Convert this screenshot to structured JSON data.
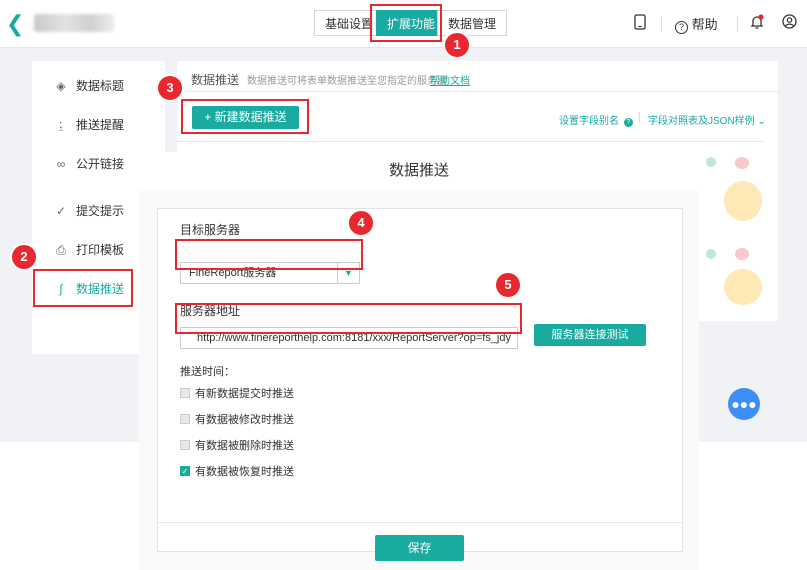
{
  "topbar": {
    "tabs": [
      "基础设置",
      "扩展功能",
      "数据管理"
    ],
    "active_tab": "扩展功能",
    "help_label": "帮助"
  },
  "sidebar": {
    "items": [
      {
        "label": "数据标题",
        "icon": "tag-icon"
      },
      {
        "label": "推送提醒",
        "icon": "bell-icon"
      },
      {
        "label": "公开链接",
        "icon": "link-icon"
      },
      {
        "label": "提交提示",
        "icon": "check-circle-icon"
      },
      {
        "label": "打印模板",
        "icon": "printer-icon"
      },
      {
        "label": "数据推送",
        "icon": "chart-icon"
      }
    ],
    "active": "数据推送"
  },
  "main": {
    "title": "数据推送",
    "description": "数据推送可将表单数据推送至您指定的服务器",
    "help_link": "帮助文档",
    "new_button": "+ 新建数据推送",
    "alias_link": "设置字段别名",
    "json_link": "字段对照表及JSON样例"
  },
  "modal": {
    "title": "数据推送",
    "target_label": "目标服务器",
    "target_value": "FineReport服务器",
    "address_label": "服务器地址",
    "address_value": "http://www.finereporthelp.com:8181/xxx/ReportServer?op=fs_jdy",
    "test_button": "服务器连接测试",
    "time_label": "推送时间：",
    "options": [
      {
        "label": "有新数据提交时推送",
        "checked": false
      },
      {
        "label": "有数据被修改时推送",
        "checked": false
      },
      {
        "label": "有数据被删除时推送",
        "checked": false
      },
      {
        "label": "有数据被恢复时推送",
        "checked": true
      }
    ],
    "save_button": "保存"
  },
  "annotations": [
    "1",
    "2",
    "3",
    "4",
    "5"
  ],
  "colors": {
    "accent": "#1aaba0",
    "highlight": "#e8272f",
    "chat": "#3d8ff5"
  }
}
